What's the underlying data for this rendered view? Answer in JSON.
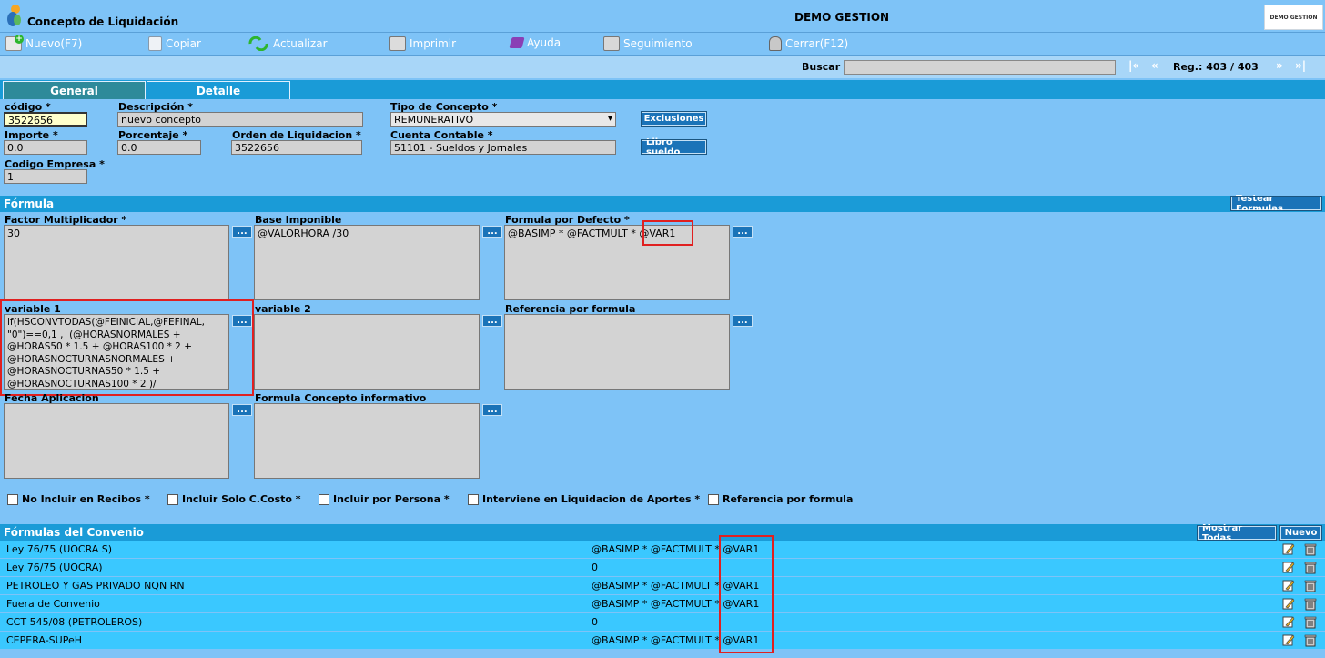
{
  "header": {
    "title": "Concepto de Liquidación",
    "company": "DEMO GESTION",
    "brand_text": "DEMO GESTION"
  },
  "toolbar": {
    "nuevo": "Nuevo(F7)",
    "copiar": "Copiar",
    "actualizar": "Actualizar",
    "imprimir": "Imprimir",
    "ayuda": "Ayuda",
    "seguimiento": "Seguimiento",
    "cerrar": "Cerrar(F12)"
  },
  "search": {
    "label": "Buscar",
    "value": "",
    "first": "|«",
    "prev": "«",
    "reg": "Reg.: 403 / 403",
    "next": "»",
    "last": "»|"
  },
  "tabs": {
    "general": "General",
    "detalle": "Detalle"
  },
  "form": {
    "codigo_label": "código *",
    "codigo": "3522656",
    "descripcion_label": "Descripción *",
    "descripcion": "nuevo concepto",
    "tipo_label": "Tipo de Concepto *",
    "tipo": "REMUNERATIVO",
    "importe_label": "Importe *",
    "importe": "0.0",
    "porcentaje_label": "Porcentaje *",
    "porcentaje": "0.0",
    "orden_label": "Orden de Liquidacion *",
    "orden": "3522656",
    "cuenta_label": "Cuenta Contable *",
    "cuenta": "51101 - Sueldos y Jornales",
    "empresa_label": "Codigo Empresa *",
    "empresa": "1",
    "exclusiones": "Exclusiones",
    "libro": "Libro sueldo"
  },
  "formula": {
    "section": "Fórmula",
    "testear": "Testear Formulas",
    "factor_label": "Factor Multiplicador *",
    "factor": "30",
    "base_label": "Base Imponible",
    "base": "@VALORHORA /30",
    "defecto_label": "Formula por Defecto *",
    "defecto_a": "@BASIMP * @FACTMULT * ",
    "defecto_b": "@VAR1",
    "var1_label": "variable 1",
    "var1": "if(HSCONVTODAS(@FEINICIAL,@FEFINAL,\n\"0\")==0,1 ,  (@HORASNORMALES +\n@HORAS50 * 1.5 + @HORAS100 * 2 +\n@HORASNOCTURNASNORMALES +\n@HORASNOCTURNAS50 * 1.5 +\n@HORASNOCTURNAS100 * 2 )/",
    "var2_label": "variable 2",
    "var2": "",
    "ref_label": "Referencia por formula",
    "ref": "",
    "fecha_label": "Fecha Aplicacion",
    "fecha": "",
    "info_label": "Formula Concepto informativo",
    "info": "",
    "dots": "..."
  },
  "checks": {
    "no_incluir": "No Incluir en Recibos *",
    "solo_ccosto": "Incluir Solo C.Costo *",
    "por_persona": "Incluir por Persona *",
    "aportes": "Interviene en Liquidacion de Aportes *",
    "referencia": "Referencia por formula"
  },
  "convenio": {
    "section": "Fórmulas del Convenio",
    "mostrar": "Mostrar Todas",
    "nuevo": "Nuevo",
    "rows": [
      {
        "name": "Ley 76/75 (UOCRA S)",
        "formula": "@BASIMP * @FACTMULT * @VAR1"
      },
      {
        "name": "Ley 76/75 (UOCRA)",
        "formula": "0"
      },
      {
        "name": "PETROLEO Y GAS PRIVADO NQN RN",
        "formula": "@BASIMP * @FACTMULT * @VAR1"
      },
      {
        "name": "Fuera de Convenio",
        "formula": "@BASIMP * @FACTMULT * @VAR1"
      },
      {
        "name": "CCT 545/08 (PETROLEROS)",
        "formula": "0"
      },
      {
        "name": "CEPERA-SUPeH",
        "formula": "@BASIMP * @FACTMULT * @VAR1"
      }
    ]
  },
  "icons": {
    "logo": "app-logo-icon",
    "nuevo": "add-icon",
    "copiar": "copy-icon",
    "actualizar": "refresh-icon",
    "imprimir": "print-icon",
    "ayuda": "help-icon",
    "seguimiento": "tracking-icon",
    "cerrar": "close-icon",
    "edit": "edit-icon",
    "delete": "trash-icon"
  },
  "colors": {
    "background": "#7ec3f7",
    "section": "#1a9bd7",
    "row": "#3ac8ff",
    "button": "#1a73b8",
    "highlight": "#e02020"
  }
}
